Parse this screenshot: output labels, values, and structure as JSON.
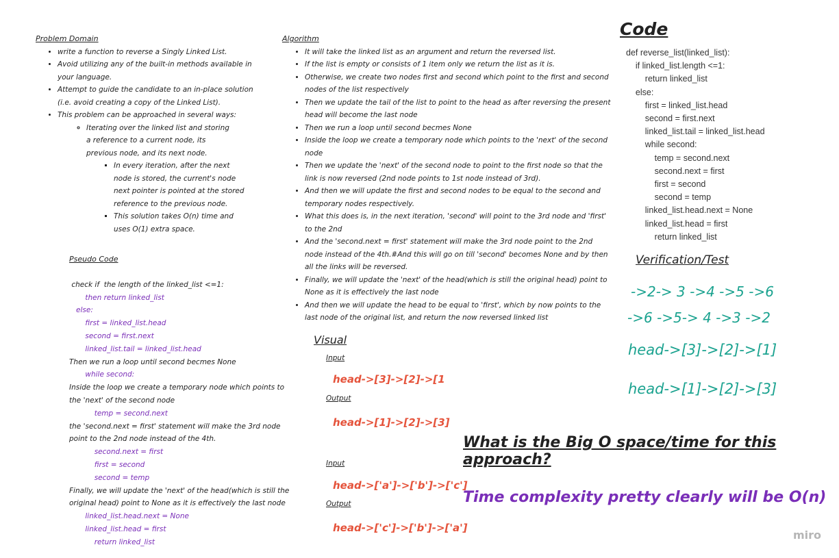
{
  "problem": {
    "title": "Problem Domain",
    "items": [
      "write a function to reverse a Singly Linked List.",
      "Avoid utilizing any of the built-in methods available in your language.",
      "Attempt to guide the candidate to an in-place solution (i.e. avoid creating a copy of the Linked List).",
      "This problem can be approached in several ways:"
    ],
    "sub": "Iterating over the linked list and storing a reference to a current node, its previous node, and its next node.",
    "subsub": [
      "In every iteration, after the next node is stored, the current's node next pointer is pointed at the stored reference to the previous node.",
      "This solution takes O(n) time and uses O(1) extra space."
    ]
  },
  "algorithm": {
    "title": "Algorithm",
    "items": [
      "It will take the linked list as an argument and return the reversed list.",
      "If the list is empty or consists of 1 item only we return the list as it is.",
      "Otherwise, we create two nodes first and second which point to the first and second nodes of the list respectively",
      "Then we update the tail of the list to point to the head as after reversing the present head will become the last node",
      "Then we run a loop until second becmes None",
      "Inside the loop we create a temporary node which points to the 'next' of the second node",
      "Then we update the 'next' of the second node to point to the first node so that the link is now reversed (2nd node points to 1st node instead of 3rd).",
      "And then we will update the first and second nodes to be equal to the second and temporary nodes respectively.",
      "What this does is, in the next iteration, 'second' will point to the 3rd node and 'first' to the 2nd",
      "And the 'second.next = first' statement will make the 3rd node point to the 2nd node instead of the 4th.#And this will go on till 'second' becomes None and by then all the links will be reversed.",
      "Finally, we will update the 'next' of the head(which is still the original head) point to None as it is effectively the last node",
      "And then we will update the head to be equal to 'first', which by now points to the last node of the original list, and return the now reversed linked list"
    ]
  },
  "pseudo": {
    "title": "Pseudo Code",
    "lines": [
      " check if  the length of the linked_list <=1:",
      "       then return linked_list",
      "   else:",
      "       first = linked_list.head",
      "       second = first.next",
      "       linked_list.tail = linked_list.head",
      "Then we run a loop until second becmes None",
      "       while second:",
      "Inside the loop we create a temporary node which points to",
      "the 'next' of the second node",
      "           temp = second.next",
      "the 'second.next = first' statement will make the 3rd node",
      "point to the 2nd node instead of the 4th.",
      "           second.next = first",
      "           first = second",
      "           second = temp",
      "Finally, we will update the 'next' of the head(which is still the",
      "original head) point to None as it is effectively the last node",
      "       linked_list.head.next = None",
      "       linked_list.head = first",
      "           return linked_list"
    ]
  },
  "code": {
    "title": "Code",
    "lines": [
      "def reverse_list(linked_list):",
      "    if linked_list.length <=1:",
      "        return linked_list",
      "    else:",
      "        first = linked_list.head",
      "        second = first.next",
      "        linked_list.tail = linked_list.head",
      "        while second:",
      "            temp = second.next",
      "            second.next = first",
      "            first = second",
      "            second = temp",
      "        linked_list.head.next = None",
      "        linked_list.head = first",
      "            return linked_list"
    ]
  },
  "verification": {
    "title": "Verification/Test",
    "lines": [
      "->2-> 3 ->4 ->5 ->6",
      "->6 ->5-> 4 ->3 ->2",
      "head->[3]->[2]->[1]",
      "head->[1]->[2]->[3]"
    ]
  },
  "visual": {
    "title": "Visual",
    "input_label": "Input",
    "output_label": "Output",
    "input1": "head->[3]->[2]->[1",
    "output1": "head->[1]->[2]->[3]",
    "input2": "head->['a']->['b']->['c']",
    "output2": "head->['c']->['b']->['a']"
  },
  "bigo": {
    "question": "What is the Big O space/time for this approach?",
    "answer": "Time complexity pretty clearly will be O(n)"
  },
  "branding": {
    "logo": "miro"
  },
  "colors": {
    "purple": "#7a2eb8",
    "teal": "#1aa28f",
    "red": "#e5533b"
  }
}
